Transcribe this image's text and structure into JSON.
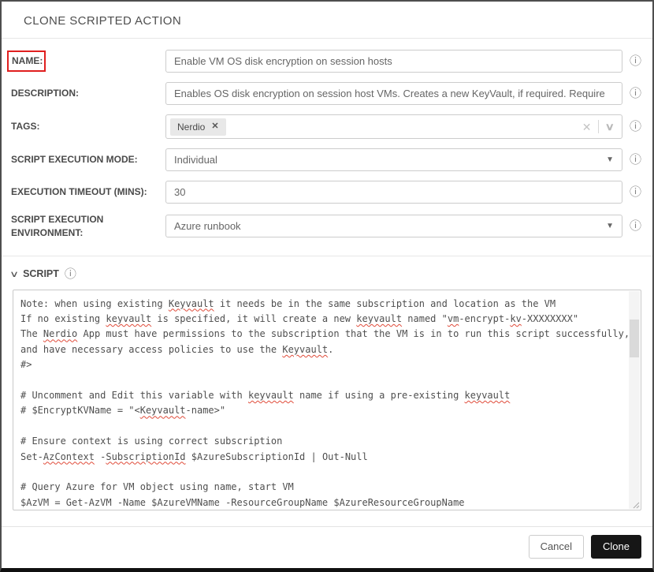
{
  "dialog": {
    "title": "CLONE SCRIPTED ACTION"
  },
  "icons": {
    "info": "ⓘ",
    "chip_remove": "✕",
    "tags_clear": "✕",
    "tags_chevron": "∨",
    "select_caret": "▼",
    "section_chevron": "∨"
  },
  "colors": {
    "annotation_red": "#e01f1f",
    "squiggle_red": "#e04b3a",
    "primary_button_bg": "#161616",
    "chip_bg": "#e8e8e8"
  },
  "fields": {
    "name": {
      "label": "NAME:",
      "value": "Enable VM OS disk encryption on session hosts"
    },
    "description": {
      "label": "DESCRIPTION:",
      "value": "Enables OS disk encryption on session host VMs. Creates a new KeyVault, if required. Require"
    },
    "tags": {
      "label": "TAGS:",
      "selected": [
        "Nerdio"
      ]
    },
    "execution_mode": {
      "label": "SCRIPT EXECUTION MODE:",
      "value": "Individual"
    },
    "timeout": {
      "label": "EXECUTION TIMEOUT (MINS):",
      "value": "30"
    },
    "environment": {
      "label": "SCRIPT EXECUTION ENVIRONMENT:",
      "value": "Azure runbook"
    }
  },
  "script_section": {
    "label": "SCRIPT",
    "lines": [
      [
        [
          "Note: when using existing ",
          false
        ],
        [
          "Keyvault",
          true
        ],
        [
          " it needs be in the same subscription and location as the VM",
          false
        ]
      ],
      [
        [
          "If no existing ",
          false
        ],
        [
          "keyvault",
          true
        ],
        [
          " is specified, it will create a new ",
          false
        ],
        [
          "keyvault",
          true
        ],
        [
          " named \"",
          false
        ],
        [
          "vm",
          true
        ],
        [
          "-encrypt-",
          false
        ],
        [
          "kv",
          true
        ],
        [
          "-XXXXXXXX\"",
          false
        ]
      ],
      [
        [
          "The ",
          false
        ],
        [
          "Nerdio",
          true
        ],
        [
          " App must have permissions to the subscription that the VM is in to run this script successfully,",
          false
        ]
      ],
      [
        [
          "and have necessary access policies to use the ",
          false
        ],
        [
          "Keyvault",
          true
        ],
        [
          ".",
          false
        ]
      ],
      [
        [
          "#>",
          false
        ]
      ],
      [],
      [
        [
          "# Uncomment and Edit this variable with ",
          false
        ],
        [
          "keyvault",
          true
        ],
        [
          " name if using a pre-existing ",
          false
        ],
        [
          "keyvault",
          true
        ]
      ],
      [
        [
          "# $EncryptKVName = \"<",
          false
        ],
        [
          "Keyvault",
          true
        ],
        [
          "-name>\"",
          false
        ]
      ],
      [],
      [
        [
          "# Ensure context is using correct subscription",
          false
        ]
      ],
      [
        [
          "Set-",
          false
        ],
        [
          "AzContext",
          true
        ],
        [
          " -",
          false
        ],
        [
          "SubscriptionId",
          true
        ],
        [
          " $AzureSubscriptionId | Out-Null",
          false
        ]
      ],
      [],
      [
        [
          "# Query Azure for VM object using name, start VM",
          false
        ]
      ],
      [
        [
          "$AzVM = Get-AzVM -Name $AzureVMName -ResourceGroupName $AzureResourceGroupName",
          false
        ]
      ]
    ]
  },
  "footer": {
    "cancel_label": "Cancel",
    "clone_label": "Clone"
  }
}
